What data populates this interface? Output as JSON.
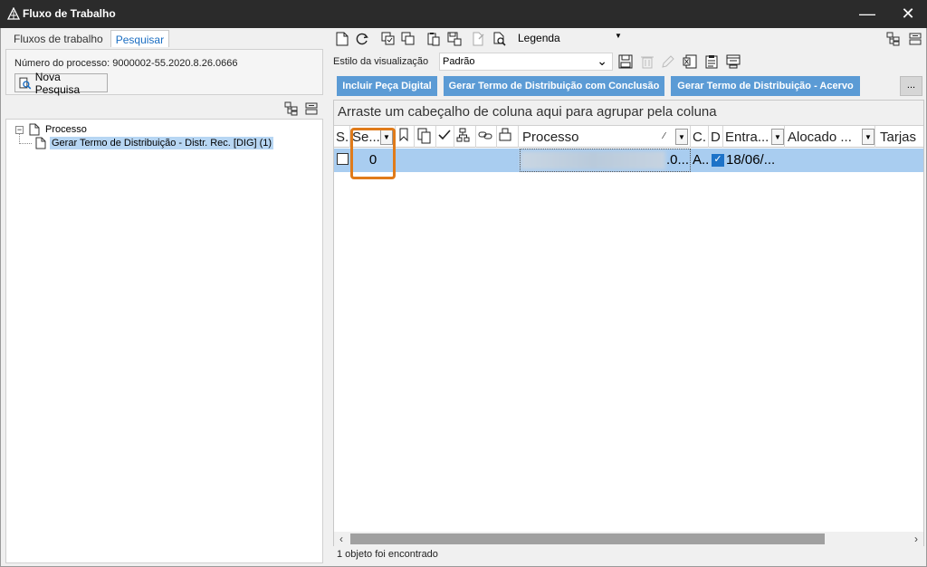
{
  "window": {
    "title": "Fluxo de Trabalho",
    "minimize_label": "—",
    "close_label": "✕"
  },
  "left": {
    "tabs": [
      {
        "label": "Fluxos de trabalho",
        "active": false
      },
      {
        "label": "Pesquisar",
        "active": true
      }
    ],
    "process_number_label": "Número do processo: 9000002-55.2020.8.26.0666",
    "new_search_button": "Nova Pesquisa",
    "tree": {
      "root_expander": "−",
      "root_label": "Processo",
      "child_label": "Gerar Termo de Distribuição - Distr. Rec. [DIG] (1)"
    }
  },
  "right": {
    "toolbar": {
      "legend_label": "Legenda",
      "legend_arrow": "▼"
    },
    "view_style": {
      "label": "Estilo da visualização",
      "value": "Padrão",
      "chevron": "⌄"
    },
    "actions": [
      "Incluir Peça Digital",
      "Gerar Termo de Distribuição com Conclusão",
      "Gerar Termo de Distribuição - Acervo"
    ],
    "more_label": "...",
    "grid": {
      "group_hint": "Arraste um cabeçalho de coluna aqui para agrupar pela coluna",
      "headers": {
        "s": "S.",
        "se": "Se...",
        "processo": "Processo",
        "sort_indicator": "⁄",
        "c": "C.",
        "d": "D",
        "entrada": "Entra...",
        "alocado": "Alocado ...",
        "tarjas": "Tarjas"
      },
      "row": {
        "se": "0",
        "processo_suffix": ".0...",
        "c": "A..",
        "d_check": "✓",
        "entrada": "18/06/..."
      }
    },
    "scroll": {
      "left_arrow": "‹",
      "right_arrow": "›"
    },
    "status": "1 objeto foi encontrado"
  },
  "colors": {
    "titlebar": "#2b2b2b",
    "action_button": "#5b9bd5",
    "selected_row": "#a9cdf0",
    "highlight": "#e07b1a"
  }
}
